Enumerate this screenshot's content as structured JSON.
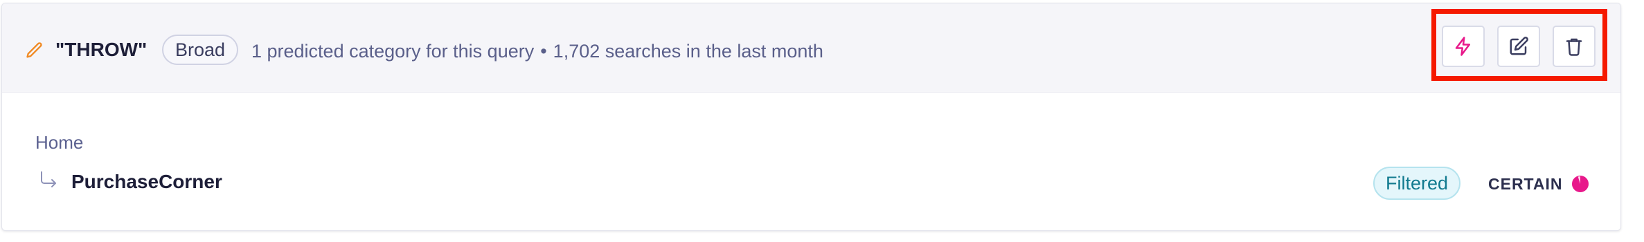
{
  "rule": {
    "term": "\"THROW\"",
    "match_type": "Broad",
    "summary": "1 predicted category for this query",
    "separator": "•",
    "searches": "1,702 searches in the last month",
    "edit_indicator_icon": "pencil-icon"
  },
  "actions": [
    {
      "name": "boost",
      "icon": "lightning-bolt-icon",
      "color": "#e8198b"
    },
    {
      "name": "edit",
      "icon": "edit-icon",
      "color": "#3a3d5f"
    },
    {
      "name": "delete",
      "icon": "trash-icon",
      "color": "#3a3d5f"
    }
  ],
  "category": {
    "parent": "Home",
    "child_indicator_icon": "arrow-return-right-icon",
    "name": "PurchaseCorner",
    "status": "Filtered",
    "confidence_label": "CERTAIN",
    "confidence_icon": "pie-indicator-icon",
    "confidence_fraction": 0.95
  },
  "colors": {
    "accent_pink": "#e8198b",
    "pencil_orange": "#f08a24",
    "status_teal": "#117a8f",
    "highlight_red": "#f51a00"
  }
}
